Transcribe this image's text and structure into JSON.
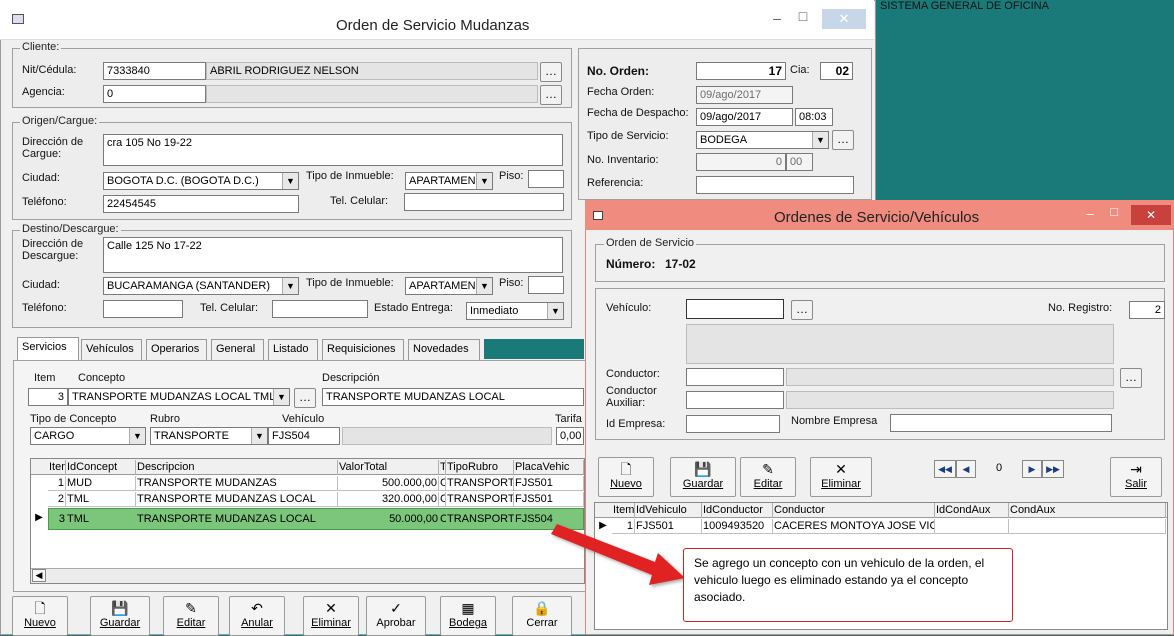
{
  "background_text": "SISTEMA GENERAL DE OFICINA",
  "main": {
    "title": "Orden de Servicio Mudanzas",
    "btn_min": "–",
    "btn_max": "□",
    "btn_close": "✕",
    "cliente": {
      "group": "Cliente:",
      "nit_label": "Nit/Cédula:",
      "nit": "7333840",
      "nombre": "ABRIL RODRIGUEZ NELSON",
      "agencia_label": "Agencia:",
      "agencia": "0"
    },
    "origen": {
      "group": "Origen/Cargue:",
      "dir_label": "Dirección de Cargue:",
      "dir": "cra 105 No 19-22",
      "ciudad_label": "Ciudad:",
      "ciudad": "BOGOTA D.C.  (BOGOTA D.C.)",
      "inmueble_label": "Tipo de Inmueble:",
      "inmueble": "APARTAMEN",
      "piso_label": "Piso:",
      "piso": "",
      "tel_label": "Teléfono:",
      "tel": "22454545",
      "cel_label": "Tel. Celular:",
      "cel": ""
    },
    "destino": {
      "group": "Destino/Descargue:",
      "dir_label": "Dirección de Descargue:",
      "dir": "Calle 125 No 17-22",
      "ciudad_label": "Ciudad:",
      "ciudad": "BUCARAMANGA  (SANTANDER)",
      "inmueble_label": "Tipo de Inmueble:",
      "inmueble": "APARTAMEN",
      "piso_label": "Piso:",
      "piso": "",
      "tel_label": "Teléfono:",
      "tel": "",
      "cel_label": "Tel. Celular:",
      "cel": "",
      "estado_label": "Estado Entrega:",
      "estado": "Inmediato"
    },
    "orden": {
      "no_label": "No. Orden:",
      "no": "17",
      "cia_label": "Cia:",
      "cia": "02",
      "fecha_label": "Fecha Orden:",
      "fecha": "09/ago/2017",
      "despacho_label": "Fecha de Despacho:",
      "despacho": "09/ago/2017",
      "hora": "08:03",
      "tipo_label": "Tipo de Servicio:",
      "tipo": "BODEGA",
      "inv_label": "No. Inventario:",
      "inv1": "0",
      "inv2": "00",
      "ref_label": "Referencia:",
      "ref": ""
    },
    "tabs": [
      "Servicios",
      "Vehículos",
      "Operarios",
      "General",
      "Listado",
      "Requisiciones",
      "Novedades"
    ],
    "servicios": {
      "item_label": "Item",
      "concepto_label": "Concepto",
      "desc_label": "Descripción",
      "item": "3",
      "concepto": "TRANSPORTE MUDANZAS LOCAL TML",
      "descripcion": "TRANSPORTE MUDANZAS LOCAL",
      "tipo_label": "Tipo de Concepto",
      "rubro_label": "Rubro",
      "veh_label": "Vehículo",
      "tarifa_label": "Tarifa",
      "tipo": "CARGO",
      "rubro": "TRANSPORTE",
      "vehiculo": "FJS504",
      "tarifa": "0,00"
    },
    "grid": {
      "headers": [
        "Item",
        "IdConcept",
        "Descripcion",
        "ValorTotal",
        "T",
        "TipoRubro",
        "PlacaVehic"
      ],
      "rows": [
        [
          "1",
          "MUD",
          "TRANSPORTE MUDANZAS",
          "500.000,00",
          "C",
          "TRANSPORT",
          "FJS501"
        ],
        [
          "2",
          "TML",
          "TRANSPORTE MUDANZAS LOCAL",
          "320.000,00",
          "C",
          "TRANSPORT",
          "FJS501"
        ],
        [
          "3",
          "TML",
          "TRANSPORTE MUDANZAS LOCAL",
          "50.000,00",
          "C",
          "TRANSPORT",
          "FJS504"
        ]
      ],
      "row_marker": "▶",
      "scroll_left": "◀"
    },
    "toolbar": [
      {
        "icon": "🗋",
        "label": "Nuevo"
      },
      {
        "icon": "💾",
        "label": "Guardar"
      },
      {
        "icon": "✎",
        "label": "Editar"
      },
      {
        "icon": "↶",
        "label": "Anular"
      },
      {
        "icon": "✕",
        "label": "Eliminar"
      },
      {
        "icon": "✓",
        "label": "Aprobar"
      },
      {
        "icon": "▦",
        "label": "Bodega"
      },
      {
        "icon": "🔒",
        "label": "Cerrar"
      }
    ]
  },
  "dialog": {
    "title": "Ordenes de Servicio/Vehículos",
    "btn_min": "–",
    "btn_max": "□",
    "btn_close": "✕",
    "group": "Orden de Servicio",
    "numero_label": "Número:",
    "numero": "17-02",
    "vehiculo_label": "Vehículo:",
    "vehiculo": "",
    "registro_label": "No. Registro:",
    "registro": "2",
    "conductor_label": "Conductor:",
    "conductor": "",
    "aux_label": "Conductor Auxiliar:",
    "aux": "",
    "empresa_label": "Id Empresa:",
    "empresa": "",
    "nombre_empresa_label": "Nombre Empresa",
    "nombre_empresa": "",
    "toolbar": [
      {
        "icon": "🗋",
        "label": "Nuevo"
      },
      {
        "icon": "💾",
        "label": "Guardar"
      },
      {
        "icon": "✎",
        "label": "Editar"
      },
      {
        "icon": "✕",
        "label": "Eliminar"
      }
    ],
    "nav": {
      "first": "◀◀",
      "prev": "◀",
      "pos": "0",
      "next": "▶",
      "last": "▶▶"
    },
    "salir": {
      "icon": "⇥",
      "label": "Salir"
    },
    "grid": {
      "headers": [
        "Item",
        "IdVehiculo",
        "IdConductor",
        "Conductor",
        "IdCondAux",
        "CondAux"
      ],
      "rows": [
        [
          "1",
          "FJS501",
          "1009493520",
          "CACERES MONTOYA JOSE VIC",
          "",
          ""
        ]
      ],
      "row_marker": "▶"
    }
  },
  "annotation": {
    "text": "Se agrego un concepto con un vehiculo de la orden, el vehiculo luego es eliminado estando ya el concepto asociado."
  },
  "colors": {
    "teal_bg": "#1a7a7a",
    "selected_row": "#7bc67b",
    "dialog_title": "#f08b80",
    "callout": "#e02020"
  }
}
